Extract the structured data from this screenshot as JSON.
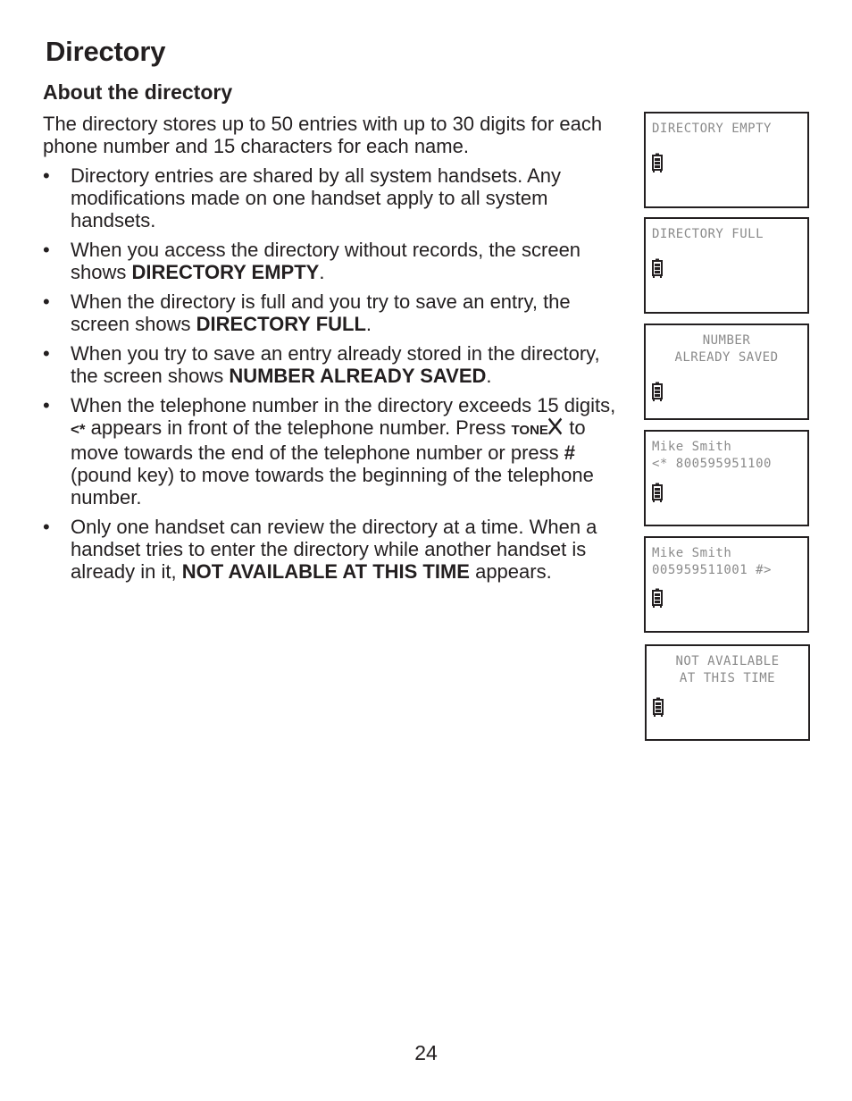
{
  "page": {
    "title": "Directory",
    "section_title": "About the directory",
    "intro": "The directory stores up to 50 entries with up to 30 digits for each phone number and 15 characters for each name.",
    "bullet_glyph": "•",
    "bullets": [
      {
        "text_before": "Directory entries are shared by all system handsets. Any modifications made on one handset apply to all system handsets."
      },
      {
        "text_before": "When you access the directory without records, the screen shows ",
        "bold": "DIRECTORY EMPTY",
        "text_after": "."
      },
      {
        "text_before": "When the directory is full and you try to save an entry, the screen shows ",
        "bold": "DIRECTORY FULL",
        "text_after": "."
      },
      {
        "text_before": "When you try to save an entry already stored in the directory, the screen shows ",
        "bold": "NUMBER ALREADY SAVED",
        "text_after": "."
      },
      {
        "text_before": "When the telephone number in the directory exceeds 15 digits, ",
        "key_star": "<*",
        "text_mid1": " appears in front of the telephone number. Press ",
        "key_tone": "TONE",
        "key_tone_glyph": "✱",
        "text_mid2": " to move towards the end of the telephone number or press ",
        "key_pound": "#",
        "text_after": " (pound key) to move towards the beginning of the telephone number."
      },
      {
        "text_before": "Only one handset can review the directory at a time. When a handset tries to enter the directory while another handset is already in it, ",
        "bold": "NOT AVAILABLE AT THIS TIME",
        "text_after": " appears."
      }
    ],
    "page_number": "24"
  },
  "screens": [
    {
      "name": "directory-empty",
      "lines": [
        "DIRECTORY EMPTY"
      ],
      "align": "left",
      "icon": "battery-icon"
    },
    {
      "name": "directory-full",
      "lines": [
        "DIRECTORY FULL"
      ],
      "align": "left",
      "icon": "battery-icon"
    },
    {
      "name": "number-already-saved",
      "lines": [
        "NUMBER",
        "ALREADY SAVED"
      ],
      "align": "center",
      "icon": "battery-icon"
    },
    {
      "name": "entry-scroll-start",
      "lines": [
        "Mike Smith",
        "<* 800595951100"
      ],
      "align": "left",
      "icon": "battery-icon"
    },
    {
      "name": "entry-scroll-end",
      "lines": [
        "Mike Smith",
        "005959511001 #>"
      ],
      "align": "left",
      "icon": "battery-icon"
    },
    {
      "name": "not-available",
      "lines": [
        "NOT AVAILABLE",
        "AT THIS TIME"
      ],
      "align": "center",
      "icon": "battery-icon"
    }
  ],
  "colors": {
    "text": "#231f20",
    "lcd_text": "#8a8a8a",
    "lcd_border": "#231f20"
  }
}
